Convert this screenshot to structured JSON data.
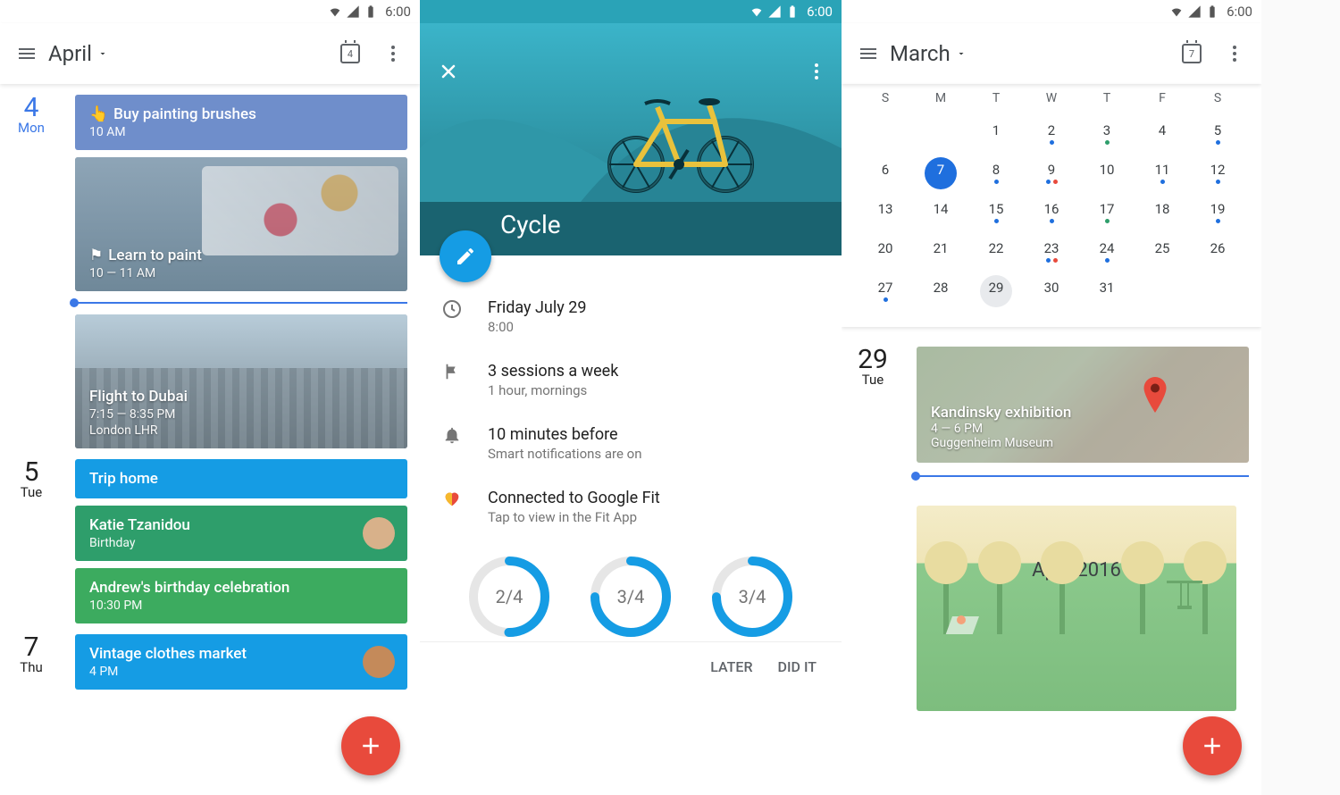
{
  "status": {
    "time": "6:00"
  },
  "pane1": {
    "month_label": "April",
    "today_num": "4",
    "days": {
      "d4": {
        "num": "4",
        "dow": "Mon"
      },
      "d5": {
        "num": "5",
        "dow": "Tue"
      },
      "d7": {
        "num": "7",
        "dow": "Thu"
      }
    },
    "events": {
      "brushes": {
        "title": "Buy painting brushes",
        "time": "10 AM"
      },
      "paint": {
        "title": "Learn to paint",
        "time": "10 — 11 AM"
      },
      "flight": {
        "title": "Flight to Dubai",
        "time": "7:15 — 8:35 PM",
        "loc": "London LHR"
      },
      "trip": {
        "title": "Trip home"
      },
      "katie": {
        "title": "Katie Tzanidou",
        "sub": "Birthday"
      },
      "andrew": {
        "title": "Andrew's birthday celebration",
        "sub": "10:30 PM"
      },
      "vintage": {
        "title": "Vintage clothes market",
        "sub": "4 PM"
      }
    }
  },
  "pane2": {
    "title": "Cycle",
    "rows": {
      "when": {
        "t1": "Friday July 29",
        "t2": "8:00"
      },
      "goal": {
        "t1": "3 sessions a week",
        "t2": "1 hour, mornings"
      },
      "remind": {
        "t1": "10 minutes before",
        "t2": "Smart notifications are on"
      },
      "fit": {
        "t1": "Connected to Google Fit",
        "t2": "Tap to view in the Fit App"
      }
    },
    "progress": {
      "p1": "2/4",
      "p2": "3/4",
      "p3": "3/4"
    },
    "actions": {
      "later": "LATER",
      "didit": "DID IT"
    }
  },
  "pane3": {
    "month_label": "March",
    "today_num": "7",
    "dow": [
      "S",
      "M",
      "T",
      "W",
      "T",
      "F",
      "S"
    ],
    "grid": [
      [
        {
          "n": ""
        },
        {
          "n": ""
        },
        {
          "n": "1"
        },
        {
          "n": "2",
          "d": [
            "b"
          ]
        },
        {
          "n": "3",
          "d": [
            "g"
          ]
        },
        {
          "n": "4"
        },
        {
          "n": "5",
          "d": [
            "b"
          ]
        }
      ],
      [
        {
          "n": "6"
        },
        {
          "n": "7",
          "sel": true
        },
        {
          "n": "8",
          "d": [
            "b"
          ]
        },
        {
          "n": "9",
          "d": [
            "b",
            "r"
          ]
        },
        {
          "n": "10"
        },
        {
          "n": "11",
          "d": [
            "b"
          ]
        },
        {
          "n": "12",
          "d": [
            "b"
          ]
        }
      ],
      [
        {
          "n": "13"
        },
        {
          "n": "14"
        },
        {
          "n": "15",
          "d": [
            "b"
          ]
        },
        {
          "n": "16",
          "d": [
            "b"
          ]
        },
        {
          "n": "17",
          "d": [
            "g"
          ]
        },
        {
          "n": "18"
        },
        {
          "n": "19",
          "d": [
            "b"
          ]
        }
      ],
      [
        {
          "n": "20"
        },
        {
          "n": "21"
        },
        {
          "n": "22"
        },
        {
          "n": "23",
          "d": [
            "b",
            "r"
          ]
        },
        {
          "n": "24",
          "d": [
            "b"
          ]
        },
        {
          "n": "25"
        },
        {
          "n": "26"
        }
      ],
      [
        {
          "n": "27",
          "d": [
            "b"
          ]
        },
        {
          "n": "28"
        },
        {
          "n": "29",
          "gray": true
        },
        {
          "n": "30"
        },
        {
          "n": "31"
        },
        {
          "n": ""
        },
        {
          "n": ""
        }
      ]
    ],
    "day29": {
      "num": "29",
      "dow": "Tue"
    },
    "event": {
      "title": "Kandinsky exhibition",
      "time": "4 — 6 PM",
      "loc": "Guggenheim Museum"
    },
    "next_month": "April 2016"
  }
}
